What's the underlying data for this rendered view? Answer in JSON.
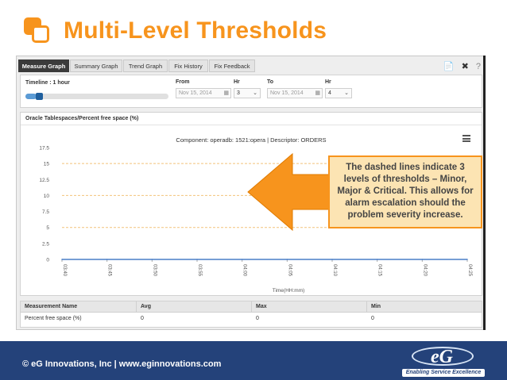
{
  "slide": {
    "title": "Multi-Level Thresholds",
    "footer": "© eG Innovations, Inc  |  www.eginnovations.com",
    "logo_text": "eG",
    "logo_tagline": "Enabling Service Excellence",
    "accent_color": "#f7941d",
    "footer_color": "#24427a"
  },
  "tabs": [
    "Measure Graph",
    "Summary Graph",
    "Trend Graph",
    "Fix History",
    "Fix Feedback"
  ],
  "toolbar_icons": [
    "document-icon",
    "tools-icon",
    "help-icon"
  ],
  "timeline": {
    "label": "Timeline : 1 hour",
    "from_label": "From",
    "from_value": "Nov 15, 2014",
    "hr1_label": "Hr",
    "hr1_value": "3",
    "to_label": "To",
    "to_value": "Nov 15, 2014",
    "hr2_label": "Hr",
    "hr2_value": "4",
    "slider_fraction": 0.08
  },
  "chart": {
    "title": "Oracle Tablespaces/Percent free space (%)",
    "subtitle": "Component: operadb: 1521:opera | Descriptor: ORDERS",
    "x_label": "Time(HH:mm)"
  },
  "chart_data": {
    "type": "line",
    "x": [
      "03:40",
      "03:45",
      "03:50",
      "03:55",
      "04:00",
      "04:05",
      "04:10",
      "04:15",
      "04:20",
      "04:25"
    ],
    "y_ticks": [
      "0",
      "2.5",
      "5",
      "7.5",
      "10",
      "12.5",
      "15",
      "17.5"
    ],
    "ylim": [
      0,
      17.5
    ],
    "thresholds": [
      5,
      10,
      15
    ],
    "series": [
      {
        "values": [
          0,
          0,
          0,
          0,
          0,
          0,
          0,
          0,
          0,
          0
        ],
        "color": "#4a7ec7"
      }
    ],
    "xlabel": "Time(HH:mm)",
    "grid": false
  },
  "table": {
    "headers": [
      "Measurement Name",
      "Avg",
      "Max",
      "Min"
    ],
    "rows": [
      [
        "Percent free space (%)",
        "0",
        "0",
        "0"
      ]
    ]
  },
  "callout": {
    "text": "The dashed lines indicate 3 levels of thresholds – Minor, Major & Critical. This allows for alarm escalation should the problem severity increase."
  }
}
